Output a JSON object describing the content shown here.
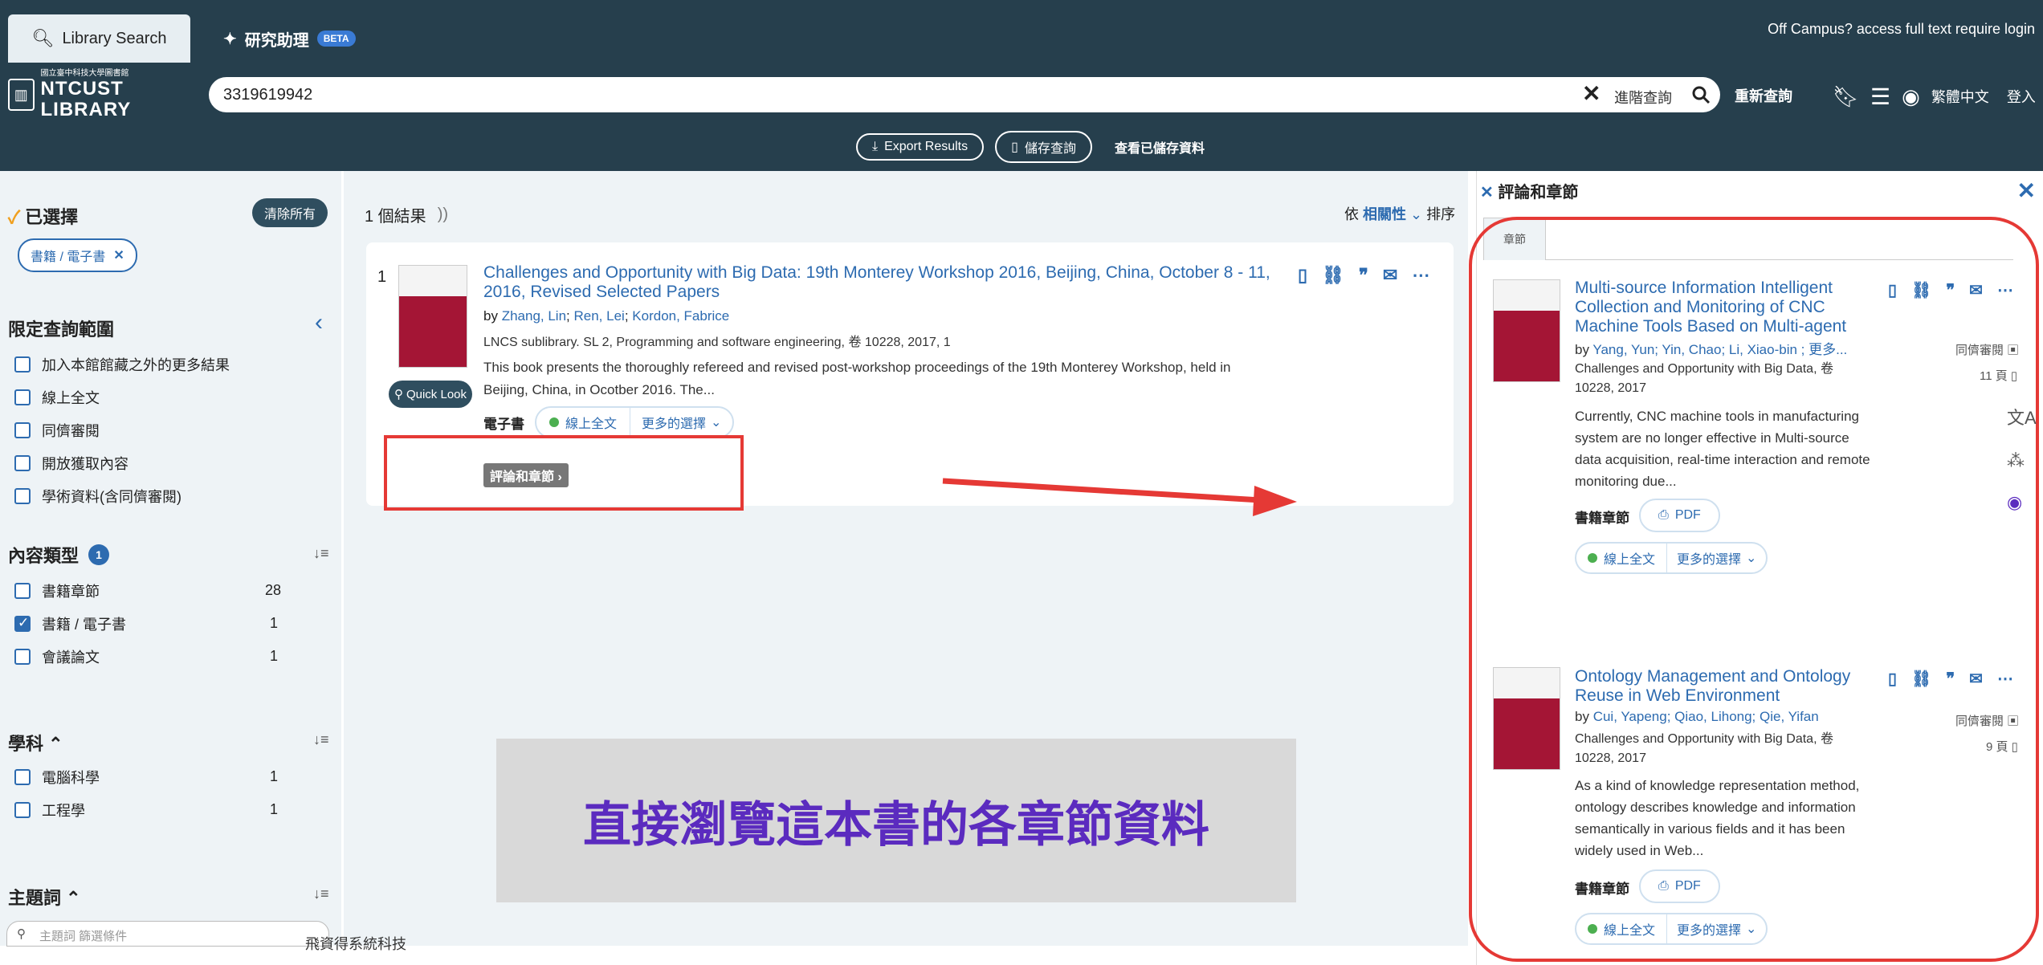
{
  "header": {
    "tab_library": "Library Search",
    "tab_assistant": "研究助理",
    "beta": "BETA",
    "offcampus": "Off Campus? access full text require login",
    "logo_line1": "國立臺中科技大學圖書館",
    "logo_line2": "NTCUST LIBRARY",
    "search_value": "3319619942",
    "advanced_search": "進階查詢",
    "requery": "重新查詢",
    "language": "繁體中文",
    "login": "登入",
    "export": "Export Results",
    "save_query": "儲存查詢",
    "view_saved": "查看已儲存資料"
  },
  "sidebar": {
    "selected_title": "已選擇",
    "clear_all": "清除所有",
    "chip": "書籍 / 電子書",
    "limit_title": "限定查詢範圍",
    "limits": [
      "加入本館館藏之外的更多結果",
      "線上全文",
      "同儕審閱",
      "開放獲取內容",
      "學術資料(含同儕審閱)"
    ],
    "content_type_title": "內容類型",
    "content_type_badge": "1",
    "content_types": [
      {
        "label": "書籍章節",
        "count": "28",
        "checked": false
      },
      {
        "label": "書籍 / 電子書",
        "count": "1",
        "checked": true
      },
      {
        "label": "會議論文",
        "count": "1",
        "checked": false
      }
    ],
    "subject_title": "學科",
    "subjects": [
      {
        "label": "電腦科學",
        "count": "1"
      },
      {
        "label": "工程學",
        "count": "1"
      }
    ],
    "topic_title": "主題詞",
    "topic_placeholder": "主題詞 篩選條件"
  },
  "results": {
    "count_label": "1 個結果",
    "sort_prefix": "依",
    "sort_value": "相關性",
    "sort_suffix": "排序",
    "item": {
      "index": "1",
      "title_line1": "Challenges and Opportunity with Big Data: 19th Monterey Workshop 2016, Beijing, China, October 8 - 11,",
      "title_line2": "2016, Revised Selected Papers",
      "by": "by",
      "authors": [
        "Zhang, Lin",
        "Ren, Lei",
        "Kordon, Fabrice"
      ],
      "source": "LNCS sublibrary. SL 2, Programming and software engineering, 卷 10228, 2017, 1",
      "abstract_line1": "This book presents the thoroughly refereed and revised post-workshop proceedings of the 19th Monterey Workshop, held in",
      "abstract_line2": "Beijing, China, in Ocotber 2016. The...",
      "quick_look": "Quick Look",
      "type": "電子書",
      "online": "線上全文",
      "more_options": "更多的選擇",
      "reviews_chapters": "評論和章節"
    },
    "annotation": "直接瀏覽這本書的各章節資料",
    "bottom_brand": "飛資得系統科技"
  },
  "panel": {
    "title": "評論和章節",
    "tab": "章節",
    "cards": [
      {
        "title": "Multi-source Information Intelligent Collection and Monitoring of CNC Machine Tools Based on Multi-agent",
        "authors_prefix": "by",
        "authors": "Yang, Yun; Yin, Chao; Li, Xiao-bin ; 更多...",
        "source": "Challenges and Opportunity with Big Data, 卷 10228, 2017",
        "peer": "同儕審閱",
        "pages": "11 頁",
        "abstract": "Currently, CNC machine tools in manufacturing system are no longer effective in Multi-source data acquisition, real-time interaction and remote monitoring due...",
        "type": "書籍章節",
        "pdf": "PDF",
        "online": "線上全文",
        "more": "更多的選擇"
      },
      {
        "title": "Ontology Management and Ontology Reuse in Web Environment",
        "authors_prefix": "by",
        "authors": "Cui, Yapeng; Qiao, Lihong; Qie, Yifan",
        "source": "Challenges and Opportunity with Big Data, 卷 10228, 2017",
        "peer": "同儕審閱",
        "pages": "9 頁",
        "abstract": "As a kind of knowledge representation method, ontology describes knowledge and information semantically in various fields and it has been widely used in Web...",
        "type": "書籍章節",
        "pdf": "PDF",
        "online": "線上全文",
        "more": "更多的選擇"
      }
    ]
  },
  "colors": {
    "header_bg": "#263f4d",
    "link": "#2d6bb0",
    "highlight_red": "#e53935",
    "annotation_text": "#5b2bbf"
  }
}
